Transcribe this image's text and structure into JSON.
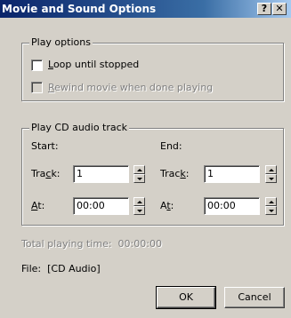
{
  "window": {
    "title": "Movie and Sound Options",
    "help_glyph": "?",
    "close_glyph": "✕"
  },
  "play_options": {
    "legend": "Play options",
    "loop": {
      "label_pre": "",
      "label_u": "L",
      "label_post": "oop until stopped",
      "checked": false
    },
    "rewind": {
      "label_pre": "",
      "label_u": "R",
      "label_post": "ewind movie when done playing",
      "checked": false,
      "disabled": true
    }
  },
  "cd_track": {
    "legend": "Play CD audio track",
    "start": {
      "heading": "Start:",
      "track_label_pre": "Tra",
      "track_label_u": "c",
      "track_label_post": "k:",
      "track_value": "1",
      "at_label_pre": "",
      "at_label_u": "A",
      "at_label_post": "t:",
      "at_value": "00:00"
    },
    "end": {
      "heading": "End:",
      "track_label_pre": "Trac",
      "track_label_u": "k",
      "track_label_post": ":",
      "track_value": "1",
      "at_label_pre": "A",
      "at_label_u": "t",
      "at_label_post": ":",
      "at_value": "00:00"
    }
  },
  "info": {
    "total_time_label": "Total playing time:",
    "total_time_value": "00:00:00",
    "file_label": "File:",
    "file_value": "[CD Audio]"
  },
  "buttons": {
    "ok": "OK",
    "cancel": "Cancel"
  }
}
